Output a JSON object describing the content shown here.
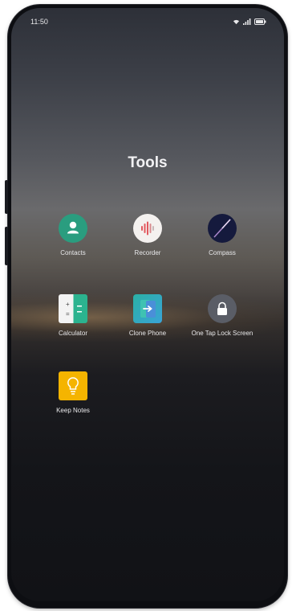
{
  "status_bar": {
    "time": "11:50",
    "icons": [
      "wifi-icon",
      "signal-icon",
      "battery-icon"
    ]
  },
  "folder": {
    "title": "Tools",
    "apps": [
      {
        "label": "Contacts",
        "icon": "contacts-icon",
        "color": "#2a9d7f"
      },
      {
        "label": "Recorder",
        "icon": "recorder-icon",
        "color": "#f4f1ef"
      },
      {
        "label": "Compass",
        "icon": "compass-icon",
        "color": "#151a3d"
      },
      {
        "label": "Calculator",
        "icon": "calculator-icon",
        "color": "#2bb38f"
      },
      {
        "label": "Clone Phone",
        "icon": "clone-phone-icon",
        "color": "#3aa3d6"
      },
      {
        "label": "One Tap Lock Screen",
        "icon": "lock-screen-icon",
        "color": "#5a5d66"
      },
      {
        "label": "Keep Notes",
        "icon": "keep-notes-icon",
        "color": "#f5b400"
      }
    ]
  }
}
